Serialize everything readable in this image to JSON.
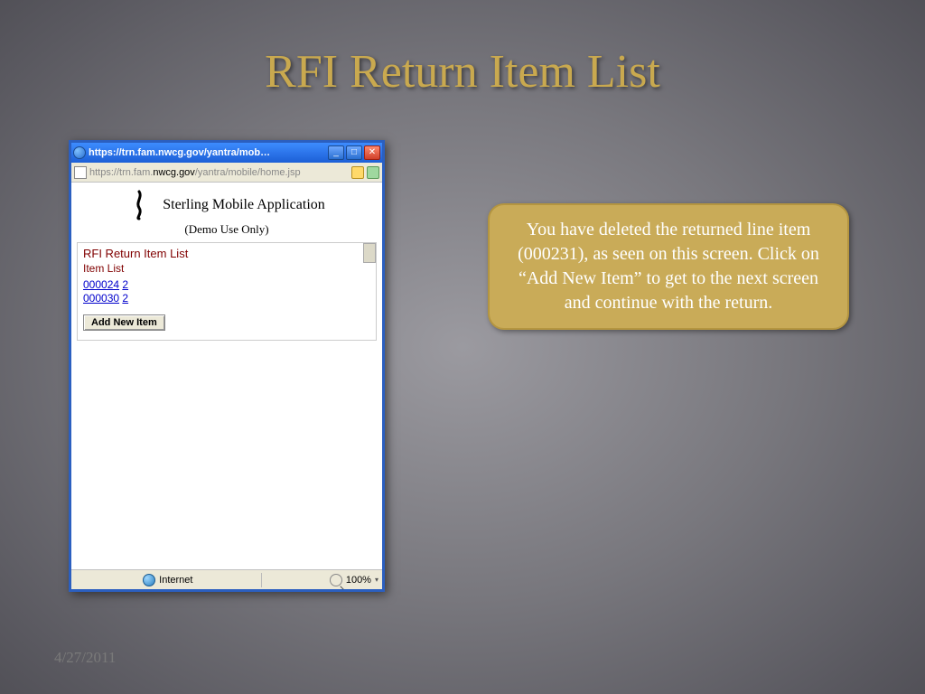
{
  "slide": {
    "title": "RFI Return Item List",
    "date": "4/27/2011"
  },
  "callout": {
    "text": "You have deleted the returned line item (000231), as seen on this screen. Click on “Add New Item” to get to the next screen and continue with the return."
  },
  "browser": {
    "title_text": "https://trn.fam.nwcg.gov/yantra/mob…",
    "url_prefix": "https",
    "url_gray1": "://trn.fam.",
    "url_dark": "nwcg.gov",
    "url_gray2": "/yantra/mobile/home.jsp",
    "window_buttons": {
      "min": "_",
      "max": "□",
      "close": "✕"
    },
    "status": {
      "zone": "Internet",
      "zoom": "100%"
    }
  },
  "page": {
    "app_name": "Sterling Mobile Application",
    "app_sub": "(Demo Use Only)",
    "section_title": "RFI Return Item List",
    "list_label": "Item List",
    "items": [
      {
        "id": "000024",
        "qty": "2"
      },
      {
        "id": "000030",
        "qty": "2"
      }
    ],
    "add_button": "Add New Item"
  }
}
